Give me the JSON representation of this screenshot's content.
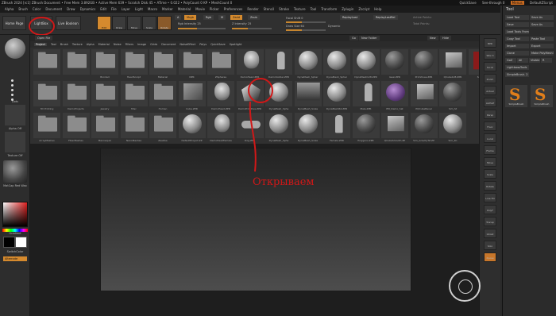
{
  "titlebar": {
    "left": "ZBrush 2024 [rc1]  ZBrush Document   • Free Mem 3.892GB  • Active Mem 639  • Scratch Disk 45  • ATime • 0.022  • PolyCount 0 KP  • MeshCount 0",
    "quicksave": "QuickSave",
    "seethrough": "See-through 0",
    "menus": "Menus",
    "script": "DefaultZScript"
  },
  "menubar": [
    "Alpha",
    "Brush",
    "Color",
    "Document",
    "Draw",
    "Dynamics",
    "Edit",
    "File",
    "Layer",
    "Light",
    "Macro",
    "Marker",
    "Material",
    "Movie",
    "Picker",
    "Preferences",
    "Render",
    "Stencil",
    "Stroke",
    "Texture",
    "Tool",
    "Transform",
    "Zplugin",
    "Zscript",
    "Help"
  ],
  "toolbar": {
    "home_page": "Home Page",
    "lightbox": "LightBox",
    "live_boolean": "Live Boolean",
    "edit": "Edit",
    "draw": "Draw",
    "move": "Move",
    "scale": "Scale",
    "rotate": "Rotate",
    "mrgb": "Mrgb",
    "rgb": "Rgb",
    "m": "M",
    "zadd": "Zadd",
    "zsub": "Zsub",
    "rgb_intensity": "Rgb Intensity 25",
    "z_intensity": "Z Intensity 25",
    "focal_shift": "Focal Shift 0",
    "draw_size": "Draw Size 64",
    "dynamic": "Dynamic",
    "replay_last": "ReplayLast",
    "replay_last_rel": "ReplayLastRel",
    "active_points": "Active Points:",
    "total_points": "Total Points:"
  },
  "leftshelf": {
    "dots": "Dots",
    "alpha_off": "Alpha Off",
    "texture_off": "Texture Off",
    "matcap": "MatCap Red Wax",
    "gradient": "Gradient",
    "switch_color": "SwitchColor",
    "alternate": "Alternate"
  },
  "lightbox": {
    "open": "Open File",
    "tabs": [
      "Project",
      "Tool",
      "Brush",
      "Texture",
      "Alpha",
      "Material",
      "Noise",
      "Filters",
      "Image",
      "Grids",
      "Document",
      "NoiseEffect",
      "Polys",
      "QuickSave",
      "Spotlight"
    ],
    "active_tab": "Project",
    "go": "Go",
    "new_folder": "New Folder",
    "new": "New",
    "hide": "Hide"
  },
  "grid": [
    {
      "label": "",
      "kind": "folder"
    },
    {
      "label": "",
      "kind": "folder"
    },
    {
      "label": "Bonded",
      "kind": "folder"
    },
    {
      "label": "HeadSculpt",
      "kind": "folder"
    },
    {
      "label": "Material",
      "kind": "folder"
    },
    {
      "label": "NPR",
      "kind": "folder"
    },
    {
      "label": "ZSpheres",
      "kind": "folder"
    },
    {
      "label": "DemoHead.ZPR",
      "kind": "head"
    },
    {
      "label": "DemoSoldier.ZPR",
      "kind": "figure"
    },
    {
      "label": "DynaMesh_Spher",
      "kind": "sphere"
    },
    {
      "label": "DynaMesh_Spher",
      "kind": "sphere"
    },
    {
      "label": "DynaMesh128.ZPR",
      "kind": "sphere"
    },
    {
      "label": "Gear.ZPR",
      "kind": "sphere-dark"
    },
    {
      "label": "Primitives.ZPR",
      "kind": "sphere-dark"
    },
    {
      "label": "QCube128.ZPR",
      "kind": "box"
    },
    {
      "label": "Sim_Ma",
      "kind": "redcube"
    },
    {
      "label": "3D Printing",
      "kind": "folder"
    },
    {
      "label": "DemoProjects",
      "kind": "folder"
    },
    {
      "label": "Jewelry",
      "kind": "folder"
    },
    {
      "label": "Misc",
      "kind": "folder"
    },
    {
      "label": "Human",
      "kind": "folder"
    },
    {
      "label": "Cube.ZPR",
      "kind": "square"
    },
    {
      "label": "DemoHead.ZPR",
      "kind": "head"
    },
    {
      "label": "DemoPrimitive.ZPR",
      "kind": "poly"
    },
    {
      "label": "DynaMesh_Sphe",
      "kind": "sphere"
    },
    {
      "label": "DynaMesh_Scale",
      "kind": "gradient"
    },
    {
      "label": "DynaMesh64.ZPR",
      "kind": "sphere"
    },
    {
      "label": "Male.ZPR",
      "kind": "figure"
    },
    {
      "label": "PM_Demo_hat",
      "kind": "purple"
    },
    {
      "label": "PQCubeBevel",
      "kind": "box"
    },
    {
      "label": "Sim_St",
      "kind": "sphere-dark"
    },
    {
      "label": "ArrayMeshes",
      "kind": "folder"
    },
    {
      "label": "FiberMeshes",
      "kind": "folder"
    },
    {
      "label": "Mannequin",
      "kind": "folder"
    },
    {
      "label": "NanoMeshes",
      "kind": "folder"
    },
    {
      "label": "ZeeZee",
      "kind": "folder"
    },
    {
      "label": "DefaultProject.ZP",
      "kind": "sphere"
    },
    {
      "label": "DemoHeadFemale",
      "kind": "head"
    },
    {
      "label": "Dog.ZPR",
      "kind": "dog"
    },
    {
      "label": "DynaMesh_Sphe",
      "kind": "sphere"
    },
    {
      "label": "DynaMesh_Scale",
      "kind": "sphere"
    },
    {
      "label": "Female.ZPR",
      "kind": "figure"
    },
    {
      "label": "Polygons.ZPR",
      "kind": "sphere-dark"
    },
    {
      "label": "QCubeSmooth.ZP",
      "kind": "box"
    },
    {
      "label": "Sim_GravityTZ.ZP",
      "kind": "sphere-dark"
    },
    {
      "label": "Sim_Ro",
      "kind": "sphere"
    }
  ],
  "annotation": "Открываем",
  "rightshelf": [
    "BPR",
    "SPix 3",
    "Scroll",
    "Zoom",
    "Actual",
    "AAHalf",
    "Persp",
    "Floor",
    "Local",
    "Frame",
    "Move",
    "Scale",
    "Rotate",
    "Line Fill",
    "PolyF",
    "Transp",
    "Ghost",
    "Solo",
    "Xpose"
  ],
  "toolpanel": {
    "title": "Tool",
    "rows": [
      [
        "Load Tool",
        "Save As"
      ],
      [
        "Save",
        "Save As"
      ],
      [
        "Load Tools From Project",
        ""
      ],
      [
        "Copy Tool",
        "Paste Tool"
      ],
      [
        "Import",
        "Export"
      ],
      [
        "Clone",
        "Make PolyMesh3D"
      ],
      [
        "GoZ",
        "All",
        "Visible",
        "R"
      ],
      [
        "Lightbox▸Tools",
        ""
      ],
      [
        "SimpleBrush. 2",
        ""
      ]
    ],
    "tool1": "SimpleBrush",
    "tool2": "SimpleBrush",
    "r": "R"
  },
  "colors": {
    "accent": "#d58a2e",
    "annotation": "#d01818"
  }
}
